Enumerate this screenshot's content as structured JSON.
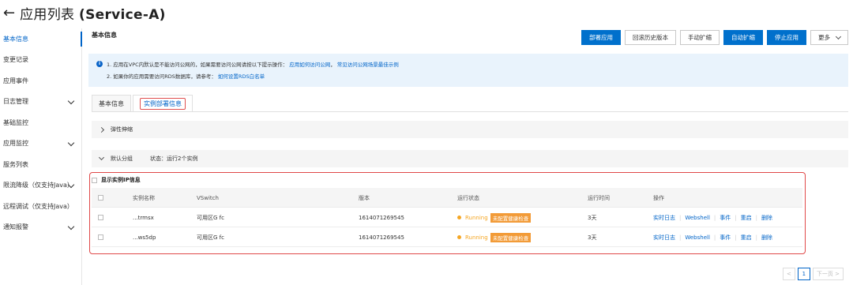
{
  "header": {
    "back_icon": "arrow-left-icon",
    "title_prefix": "应用列表 ",
    "title_app": "(Service-A)"
  },
  "sidebar": {
    "items": [
      {
        "label": "基本信息",
        "active": true,
        "expandable": false
      },
      {
        "label": "变更记录",
        "expandable": false
      },
      {
        "label": "应用事件",
        "expandable": false
      },
      {
        "label": "日志管理",
        "expandable": true
      },
      {
        "label": "基础监控",
        "expandable": false
      },
      {
        "label": "应用监控",
        "expandable": true
      },
      {
        "label": "服务列表",
        "expandable": false
      },
      {
        "label": "限流降级（仅支持Java）",
        "expandable": true
      },
      {
        "label": "远程调试（仅支持Java）",
        "expandable": false
      },
      {
        "label": "通知报警",
        "expandable": true
      }
    ]
  },
  "main": {
    "section_title": "基本信息",
    "toolbar": {
      "deploy": "部署应用",
      "rollback": "回滚历史版本",
      "manual_scale": "手动扩缩",
      "auto_scale": "自动扩缩",
      "stop": "停止应用",
      "more": "更多"
    },
    "notice": {
      "line1": "1. 应用在VPC内默认是不能访问公网的，如果需要访问公网请按以下提示操作：",
      "link1": "应用如何访问公网",
      "link1_sep": "，",
      "link2": "常见访问公网场景最佳示例",
      "line2": "2. 如果你的应用需要访问RDS数据库，请参考：",
      "link3": "如何设置RDS白名单"
    },
    "tabs": [
      {
        "label": "基本信息"
      },
      {
        "label": "实例部署信息",
        "active": true
      }
    ],
    "elastic_label": "弹性伸缩",
    "group": {
      "name": "默认分组",
      "status": "状态：运行2个实例"
    },
    "show_ip_label": "显示实例IP信息",
    "table": {
      "columns": {
        "name": "实例名称",
        "vswitch": "VSwitch",
        "version": "版本",
        "state": "运行状态",
        "uptime": "运行时间",
        "ops": "操作"
      },
      "rows": [
        {
          "name": "...trmsx",
          "vswitch": "可用区G fc",
          "version": "1614071269545",
          "state": "Running",
          "health": "未配置健康检查",
          "uptime": "3天"
        },
        {
          "name": "...ws5dp",
          "vswitch": "可用区G fc",
          "version": "1614071269545",
          "state": "Running",
          "health": "未配置健康检查",
          "uptime": "3天"
        }
      ],
      "ops": {
        "log": "实时日志",
        "webshell": "Webshell",
        "event": "事件",
        "restart": "重启",
        "delete": "删除"
      }
    },
    "pager": {
      "prev": "<",
      "current": "1",
      "next": "下一页 >"
    }
  },
  "colors": {
    "primary": "#0070cc",
    "link": "#0064c8",
    "warning": "#f29b38",
    "highlight_border": "#e04848",
    "notice_bg": "#e9f3fc"
  }
}
